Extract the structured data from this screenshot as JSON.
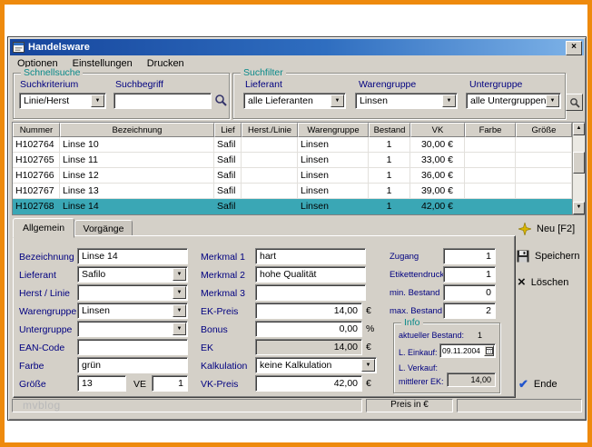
{
  "colors": {
    "frame_orange": "#EE8A0D",
    "titlebar_left": "#16459C",
    "titlebar_right": "#7EB3E8",
    "selection_teal": "#3AA7B5",
    "group_title_teal": "#0A8A8A",
    "label_navy": "#000080",
    "window_gray": "#D4D0C8"
  },
  "window": {
    "title": "Handelsware"
  },
  "menu": {
    "items": [
      {
        "label": "Optionen"
      },
      {
        "label": "Einstellungen"
      },
      {
        "label": "Drucken"
      }
    ]
  },
  "quick_search": {
    "title": "Schnellsuche",
    "criterion_label": "Suchkriterium",
    "criterion_value": "Linie/Herst",
    "term_label": "Suchbegriff",
    "term_value": ""
  },
  "filter": {
    "title": "Suchfilter",
    "lieferant_label": "Lieferant",
    "lieferant_value": "alle Lieferanten",
    "warengruppe_label": "Warengruppe",
    "warengruppe_value": "Linsen",
    "untergruppe_label": "Untergruppe",
    "untergruppe_value": "alle Untergruppen"
  },
  "table": {
    "columns": [
      "Nummer",
      "Bezeichnung",
      "Lief",
      "Herst./Linie",
      "Warengruppe",
      "Bestand",
      "VK",
      "Farbe",
      "Größe"
    ],
    "selected_row": 4,
    "rows": [
      {
        "cells": [
          "H102764",
          "Linse 10",
          "Safil",
          "",
          "Linsen",
          "1",
          "30,00 €",
          "",
          ""
        ]
      },
      {
        "cells": [
          "H102765",
          "Linse 11",
          "Safil",
          "",
          "Linsen",
          "1",
          "33,00 €",
          "",
          ""
        ]
      },
      {
        "cells": [
          "H102766",
          "Linse 12",
          "Safil",
          "",
          "Linsen",
          "1",
          "36,00 €",
          "",
          ""
        ]
      },
      {
        "cells": [
          "H102767",
          "Linse 13",
          "Safil",
          "",
          "Linsen",
          "1",
          "39,00 €",
          "",
          ""
        ]
      },
      {
        "cells": [
          "H102768",
          "Linse 14",
          "Safil",
          "",
          "Linsen",
          "1",
          "42,00 €",
          "",
          ""
        ]
      }
    ]
  },
  "tabs": [
    {
      "label": "Allgemein"
    },
    {
      "label": "Vorgänge"
    }
  ],
  "form": {
    "bezeichnung": {
      "label": "Bezeichnung",
      "value": "Linse 14"
    },
    "lieferant": {
      "label": "Lieferant",
      "value": "Safilo"
    },
    "herst_linie": {
      "label": "Herst / Linie",
      "value": ""
    },
    "warengruppe": {
      "label": "Warengruppe",
      "value": "Linsen"
    },
    "untergruppe": {
      "label": "Untergruppe",
      "value": ""
    },
    "ean_code": {
      "label": "EAN-Code",
      "value": ""
    },
    "farbe": {
      "label": "Farbe",
      "value": "grün"
    },
    "groesse": {
      "label": "Größe",
      "value": "13",
      "ve_label": "VE",
      "ve_value": "1"
    },
    "merkmal1": {
      "label": "Merkmal 1",
      "value": "hart"
    },
    "merkmal2": {
      "label": "Merkmal 2",
      "value": "hohe Qualität"
    },
    "merkmal3": {
      "label": "Merkmal 3",
      "value": ""
    },
    "ek_preis": {
      "label": "EK-Preis",
      "value": "14,00",
      "suffix": "€"
    },
    "bonus": {
      "label": "Bonus",
      "value": "0,00",
      "suffix": "%"
    },
    "ek": {
      "label": "EK",
      "value": "14,00",
      "suffix": "€"
    },
    "kalkulation": {
      "label": "Kalkulation",
      "value": "keine Kalkulation"
    },
    "vk_preis": {
      "label": "VK-Preis",
      "value": "42,00",
      "suffix": "€"
    },
    "zugang": {
      "label": "Zugang",
      "value": "1"
    },
    "etikettendruck": {
      "label": "Etikettendruck",
      "value": "1"
    },
    "min_bestand": {
      "label": "min. Bestand",
      "value": "0"
    },
    "max_bestand": {
      "label": "max. Bestand",
      "value": "2"
    },
    "info": {
      "title": "Info",
      "aktueller_bestand_label": "aktueller Bestand:",
      "aktueller_bestand_value": "1",
      "l_einkauf_label": "L. Einkauf:",
      "l_einkauf_value": "09.11.2004",
      "l_verkauf_label": "L. Verkauf:",
      "l_verkauf_value": "",
      "mittlerer_ek_label": "mittlerer EK:",
      "mittlerer_ek_value": "14,00"
    }
  },
  "actions": {
    "new_label": "Neu [F2]",
    "save_label": "Speichern",
    "delete_label": "Löschen",
    "end_label": "Ende"
  },
  "status": {
    "price_note": "Preis in €",
    "watermark": "mvblog"
  }
}
